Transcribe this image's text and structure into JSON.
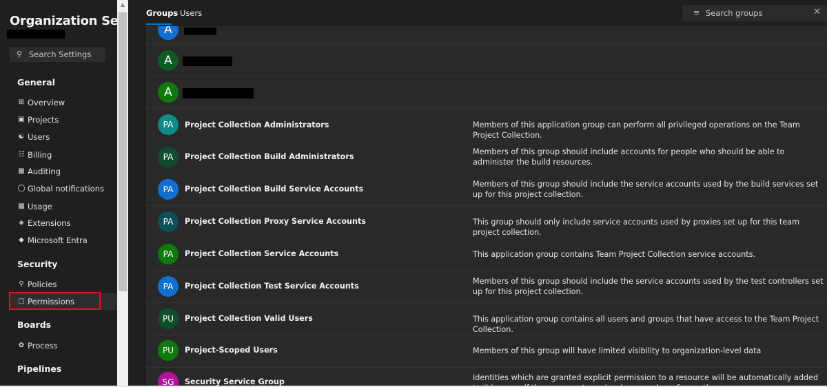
{
  "sidebar": {
    "org_title": "Organization Setti...",
    "search_placeholder": "Search Settings",
    "sections": [
      {
        "heading": "General",
        "items": [
          {
            "label": "Overview",
            "icon": "grid-icon"
          },
          {
            "label": "Projects",
            "icon": "projects-icon"
          },
          {
            "label": "Users",
            "icon": "users-icon"
          },
          {
            "label": "Billing",
            "icon": "billing-icon"
          },
          {
            "label": "Auditing",
            "icon": "auditing-icon"
          },
          {
            "label": "Global notifications",
            "icon": "notifications-icon"
          },
          {
            "label": "Usage",
            "icon": "usage-icon"
          },
          {
            "label": "Extensions",
            "icon": "extensions-icon"
          },
          {
            "label": "Microsoft Entra",
            "icon": "entra-icon"
          }
        ]
      },
      {
        "heading": "Security",
        "items": [
          {
            "label": "Policies",
            "icon": "policies-icon"
          },
          {
            "label": "Permissions",
            "icon": "lock-icon",
            "selected": true
          }
        ]
      },
      {
        "heading": "Boards",
        "items": [
          {
            "label": "Process",
            "icon": "process-icon"
          }
        ]
      },
      {
        "heading": "Pipelines",
        "items": []
      }
    ]
  },
  "tabs": [
    {
      "label": "Groups",
      "active": true
    },
    {
      "label": "Users",
      "active": false
    }
  ],
  "group_search_placeholder": "Search groups",
  "groups": [
    {
      "initials": "A",
      "name": "",
      "description": "",
      "color": "#0f6fd6"
    },
    {
      "initials": "A",
      "name": "",
      "description": "",
      "color": "#0e5a25"
    },
    {
      "initials": "A",
      "name": "",
      "description": "",
      "color": "#0e7a0d"
    },
    {
      "initials": "PA",
      "name": "Project Collection Administrators",
      "description": "Members of this application group can perform all privileged operations on the Team Project Collection.",
      "color": "#0f8a86"
    },
    {
      "initials": "PA",
      "name": "Project Collection Build Administrators",
      "description": "Members of this group should include accounts for people who should be able to administer the build resources.",
      "color": "#104d2c"
    },
    {
      "initials": "PA",
      "name": "Project Collection Build Service Accounts",
      "description": "Members of this group should include the service accounts used by the build services set up for this project collection.",
      "color": "#1170cf"
    },
    {
      "initials": "PA",
      "name": "Project Collection Proxy Service Accounts",
      "description": "This group should only include service accounts used by proxies set up for this team project collection.",
      "color": "#0d4f58"
    },
    {
      "initials": "PA",
      "name": "Project Collection Service Accounts",
      "description": "This application group contains Team Project Collection service accounts.",
      "color": "#0e7a0d"
    },
    {
      "initials": "PA",
      "name": "Project Collection Test Service Accounts",
      "description": "Members of this group should include the service accounts used by the test controllers set up for this project collection.",
      "color": "#1170cf"
    },
    {
      "initials": "PU",
      "name": "Project Collection Valid Users",
      "description": "This application group contains all users and groups that have access to the Team Project Collection.",
      "color": "#0e4f28"
    },
    {
      "initials": "PU",
      "name": "Project-Scoped Users",
      "description": "Members of this group will have limited visibility to organization-level data",
      "color": "#0e7a0d"
    },
    {
      "initials": "SG",
      "name": "Security Service Group",
      "description": "Identities which are granted explicit permission to a resource will be automatically added to this group if they were not previously a member of any other group.",
      "color": "#b4139e"
    }
  ]
}
